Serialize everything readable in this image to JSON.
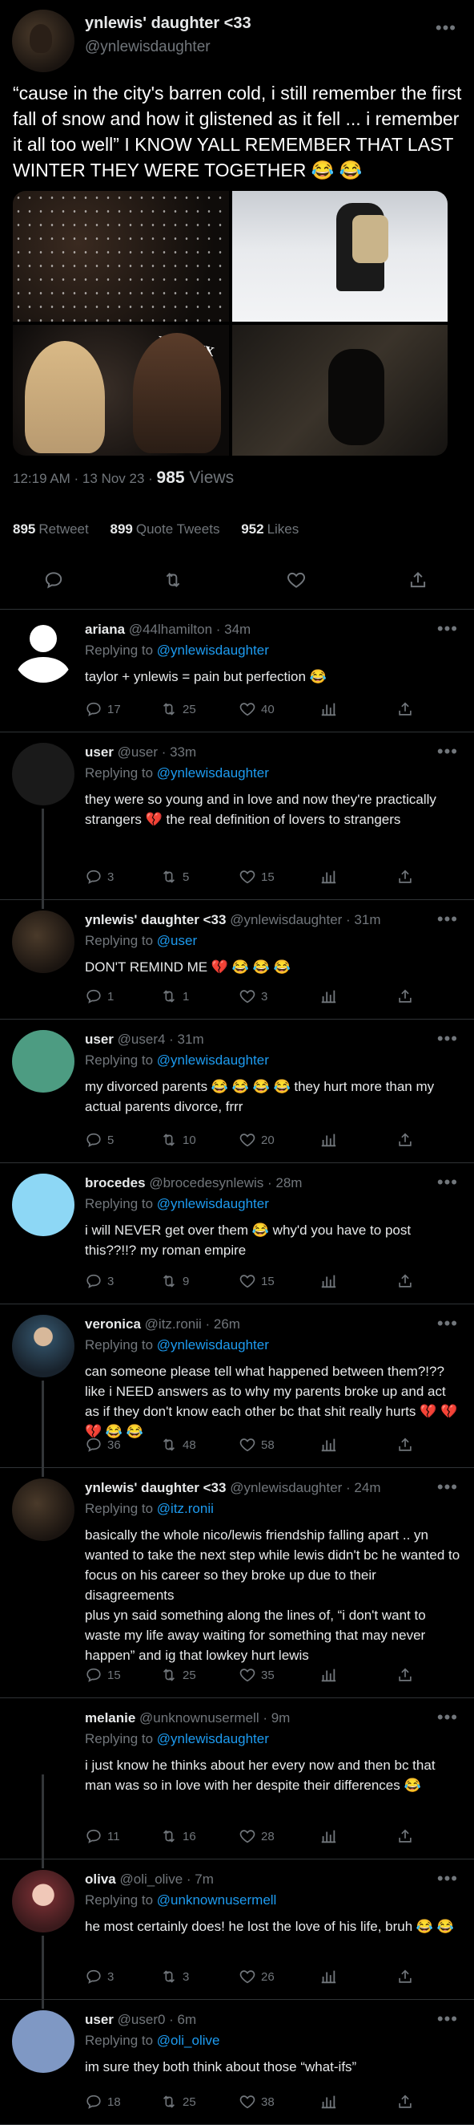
{
  "main": {
    "author_name": "ynlewis' daughter <33",
    "author_handle": "@ynlewisdaughter",
    "text": "“cause in the city's barren cold, i still remember the first fall of snow and how it glistened as it fell ... i remember it all too well” I KNOW YALL REMEMBER THAT LAST WINTER THEY WERE TOGETHER 😂 😂",
    "image_text": "POLITIX",
    "time": "12:19 AM · 13 Nov 23 · ",
    "views_count": "985",
    "views_label": " Views",
    "retweets_count": "895",
    "retweets_label": "Retweet",
    "quotes_count": "899",
    "quotes_label": "Quote Tweets",
    "likes_count": "952",
    "likes_label": "Likes"
  },
  "replies": [
    {
      "name": "ariana",
      "handle": "@44lhamilton",
      "time": " · 34m",
      "replying_label": "Replying to ",
      "replying_to": "@ynlewisdaughter",
      "text": "taylor + ynlewis = pain but perfection 😂",
      "replies": "17",
      "retweets": "25",
      "likes": "40",
      "avatar": "default-white"
    },
    {
      "name": "user",
      "handle": "@user",
      "time": " · 33m",
      "replying_label": "Replying to ",
      "replying_to": "@ynlewisdaughter",
      "text": "they were so young and in love and now they're practically strangers 💔 the real definition of lovers to strangers",
      "replies": "3",
      "retweets": "5",
      "likes": "15",
      "avatar": "dark"
    },
    {
      "name": "ynlewis' daughter <33",
      "handle": "@ynlewisdaughter",
      "time": " · 31m",
      "replying_label": "Replying to ",
      "replying_to": "@user",
      "text": "DON'T REMIND ME 💔 😂 😂 😂",
      "replies": "1",
      "retweets": "1",
      "likes": "3",
      "avatar": "photo"
    },
    {
      "name": "user",
      "handle": "@user4",
      "time": " · 31m",
      "replying_label": "Replying to ",
      "replying_to": "@ynlewisdaughter",
      "text": "my divorced parents 😂 😂 😂 😂  they hurt more than my actual parents divorce, frrr",
      "replies": "5",
      "retweets": "10",
      "likes": "20",
      "avatar": "#4d9c82"
    },
    {
      "name": "brocedes",
      "handle": "@brocedesynlewis",
      "time": " · 28m",
      "replying_label": "Replying to ",
      "replying_to": "@ynlewisdaughter",
      "text": "i will NEVER get over them 😂 why'd you have to post this??!!? my roman empire",
      "replies": "3",
      "retweets": "9",
      "likes": "15",
      "avatar": "#8dd7f5"
    },
    {
      "name": "veronica",
      "handle": "@itz.ronii",
      "time": " · 26m",
      "replying_label": "Replying to ",
      "replying_to": "@ynlewisdaughter",
      "text": "can someone please tell what happened between them?!?? like i NEED answers as to why my parents broke up and act as if they don't know each other bc that shit really hurts 💔 💔 💔 😂 😂",
      "replies": "36",
      "retweets": "48",
      "likes": "58",
      "avatar": "person"
    },
    {
      "name": "ynlewis' daughter <33",
      "handle": "@ynlewisdaughter",
      "time": " · 24m",
      "replying_label": "Replying to ",
      "replying_to": "@itz.ronii",
      "text": "basically the whole nico/lewis friendship falling apart .. yn wanted to take the next step while lewis didn't bc he wanted to focus on his career so they broke up due to their disagreements\nplus yn said something along the lines of, “i don't want to waste my life away waiting for something that may never happen” and ig that lowkey hurt lewis",
      "replies": "15",
      "retweets": "25",
      "likes": "35",
      "avatar": "photo"
    },
    {
      "name": "melanie",
      "handle": "@unknownusermell",
      "time": " · 9m",
      "replying_label": "Replying to ",
      "replying_to": "@ynlewisdaughter",
      "text": "i just know he thinks about her every now and then bc that man was so in love with her despite their differences 😂",
      "replies": "11",
      "retweets": "16",
      "likes": "28",
      "avatar": "none"
    },
    {
      "name": "oliva",
      "handle": "@oli_olive",
      "time": " · 7m",
      "replying_label": "Replying to ",
      "replying_to": "@unknownusermell",
      "text": "he most certainly does! he lost the love of his life, bruh 😂 😂",
      "replies": "3",
      "retweets": "3",
      "likes": "26",
      "avatar": "cartoon"
    },
    {
      "name": "user",
      "handle": "@user0",
      "time": " · 6m",
      "replying_label": "Replying to ",
      "replying_to": "@oli_olive",
      "text": "im sure they both think about those “what-ifs”",
      "replies": "18",
      "retweets": "25",
      "likes": "38",
      "avatar": "#7f98c4"
    }
  ],
  "colors": {
    "accent": "#1d9bf0",
    "muted": "#71767b",
    "text": "#e7e9ea",
    "divider": "#2f3336"
  }
}
